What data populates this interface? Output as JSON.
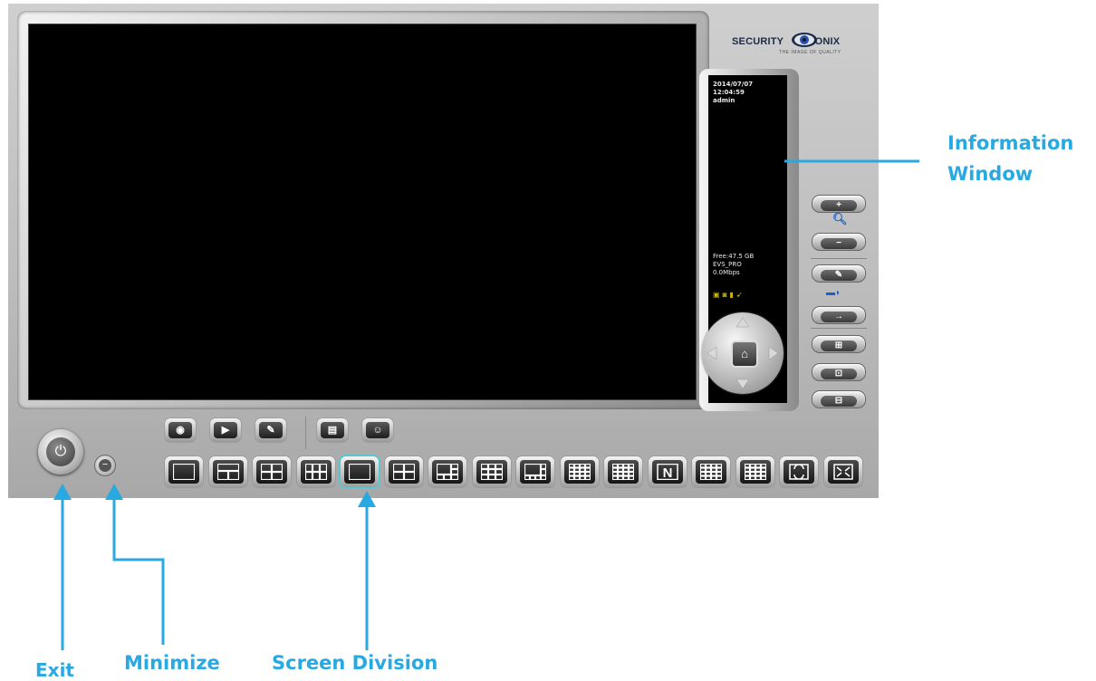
{
  "logo": {
    "text": "SECURITY      TRONIX",
    "tagline": "THE IMAGE OF QUALITY"
  },
  "info_window": {
    "date": "2014/07/07",
    "time": "12:04:59",
    "user": "admin",
    "free_space": "Free:47.5 GB",
    "model": "EVS_PRO",
    "bitrate": "0.0Mbps",
    "status_icons": [
      "monitor-icon",
      "camera-icon",
      "battery-icon",
      "network-icon"
    ]
  },
  "side_controls": {
    "zoom_in_label": "+",
    "zoom_out_label": "−",
    "zoom_icon": "magnifier-icon",
    "settings_icon": "wrench-icon",
    "audio_icon": "speaker-icon",
    "forward_icon": "arrow-right-icon",
    "focus_icons": [
      "focus-near-icon",
      "focus-far-icon",
      "iris-icon"
    ]
  },
  "toolbar": {
    "buttons": [
      "record-icon",
      "playback-icon",
      "setup-wrench-icon",
      "event-log-icon",
      "chat-icon"
    ]
  },
  "screen_division": {
    "buttons": [
      "1x1-wide",
      "2x2a",
      "2x2b",
      "3x3a",
      "single",
      "2x2",
      "1+5",
      "3x3",
      "1+7",
      "4x4a",
      "4x4b",
      "N",
      "1+12",
      "1+9",
      "sequence",
      "fullscreen"
    ],
    "selected_index": 4,
    "n_label": "N"
  },
  "callouts": {
    "information_window_line1": "Information",
    "information_window_line2": "Window",
    "exit": "Exit",
    "minimize": "Minimize",
    "screen_division": "Screen Division"
  },
  "colors": {
    "callout": "#29a9e1",
    "panel": "#bdbdbd",
    "selected_outline": "#59c7cf"
  }
}
